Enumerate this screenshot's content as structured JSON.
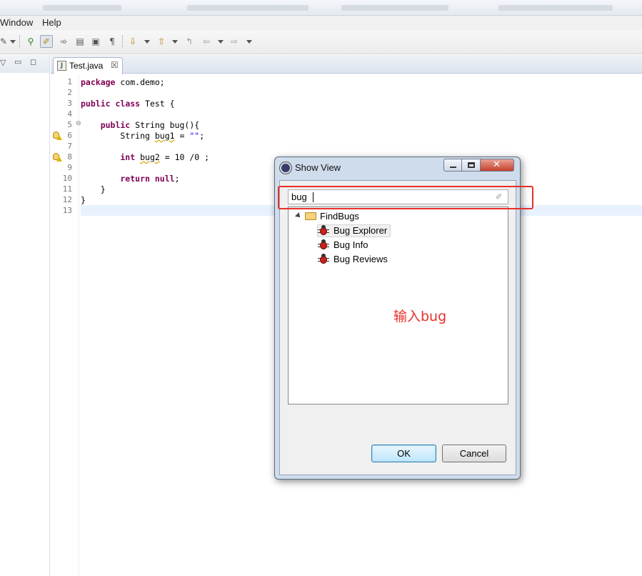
{
  "menu": {
    "items": [
      "Window",
      "Help"
    ]
  },
  "editor": {
    "tab_title": "Test.java",
    "line_numbers": [
      "1",
      "2",
      "3",
      "4",
      "5",
      "6",
      "7",
      "8",
      "9",
      "10",
      "11",
      "12",
      "13"
    ],
    "fold_marker": "⊖",
    "warning_lines": [
      6,
      8
    ]
  },
  "code": {
    "l1_kw": "package",
    "l1_rest": " com.demo;",
    "l3_kw1": "public",
    "l3_kw2": " class",
    "l3_rest": " Test {",
    "l5_kw": "    public",
    "l5_rest": " String bug(){",
    "l6_a": "        String ",
    "l6_var": "bug1",
    "l6_b": " = ",
    "l6_str": "\"\"",
    "l6_c": ";",
    "l8_kw": "        int",
    "l8_a": " ",
    "l8_var": "bug2",
    "l8_b": " = 10 /0 ;",
    "l10_kw": "        return",
    "l10_kw2": " null",
    "l10_rest": ";",
    "l11": "    }",
    "l12": "}"
  },
  "dialog": {
    "title": "Show View",
    "filter_value": "bug",
    "tree": {
      "category": "FindBugs",
      "items": [
        "Bug Explorer",
        "Bug Info",
        "Bug Reviews"
      ]
    },
    "ok_label": "OK",
    "cancel_label": "Cancel"
  },
  "annotation": {
    "text": "输入bug",
    "color": "#e8302a"
  }
}
